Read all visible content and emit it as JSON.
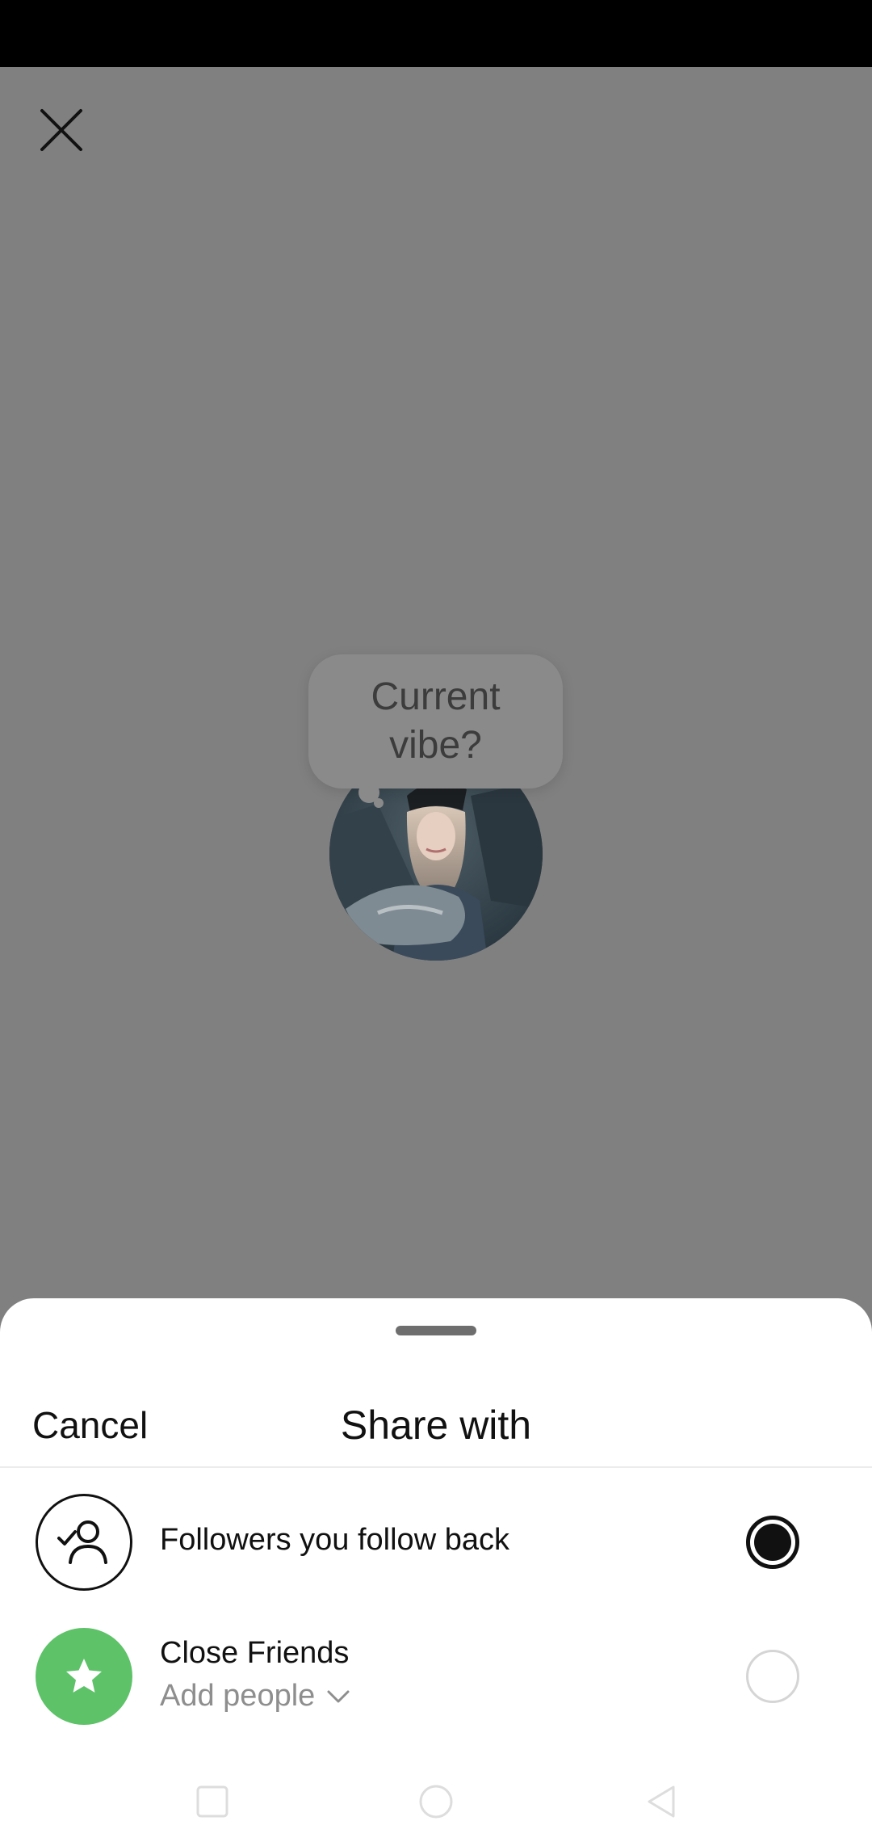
{
  "prompt": {
    "text_line1": "Current",
    "text_line2": "vibe?"
  },
  "share_sheet": {
    "cancel_label": "Cancel",
    "title": "Share with",
    "options": [
      {
        "label": "Followers you follow back",
        "selected": true,
        "icon": "person-check-icon"
      },
      {
        "label": "Close Friends",
        "sub_label": "Add people",
        "selected": false,
        "icon": "star-icon"
      }
    ]
  },
  "colors": {
    "backdrop": "#808080",
    "close_friends_green": "#5ec269",
    "selected_radio": "#111111"
  }
}
